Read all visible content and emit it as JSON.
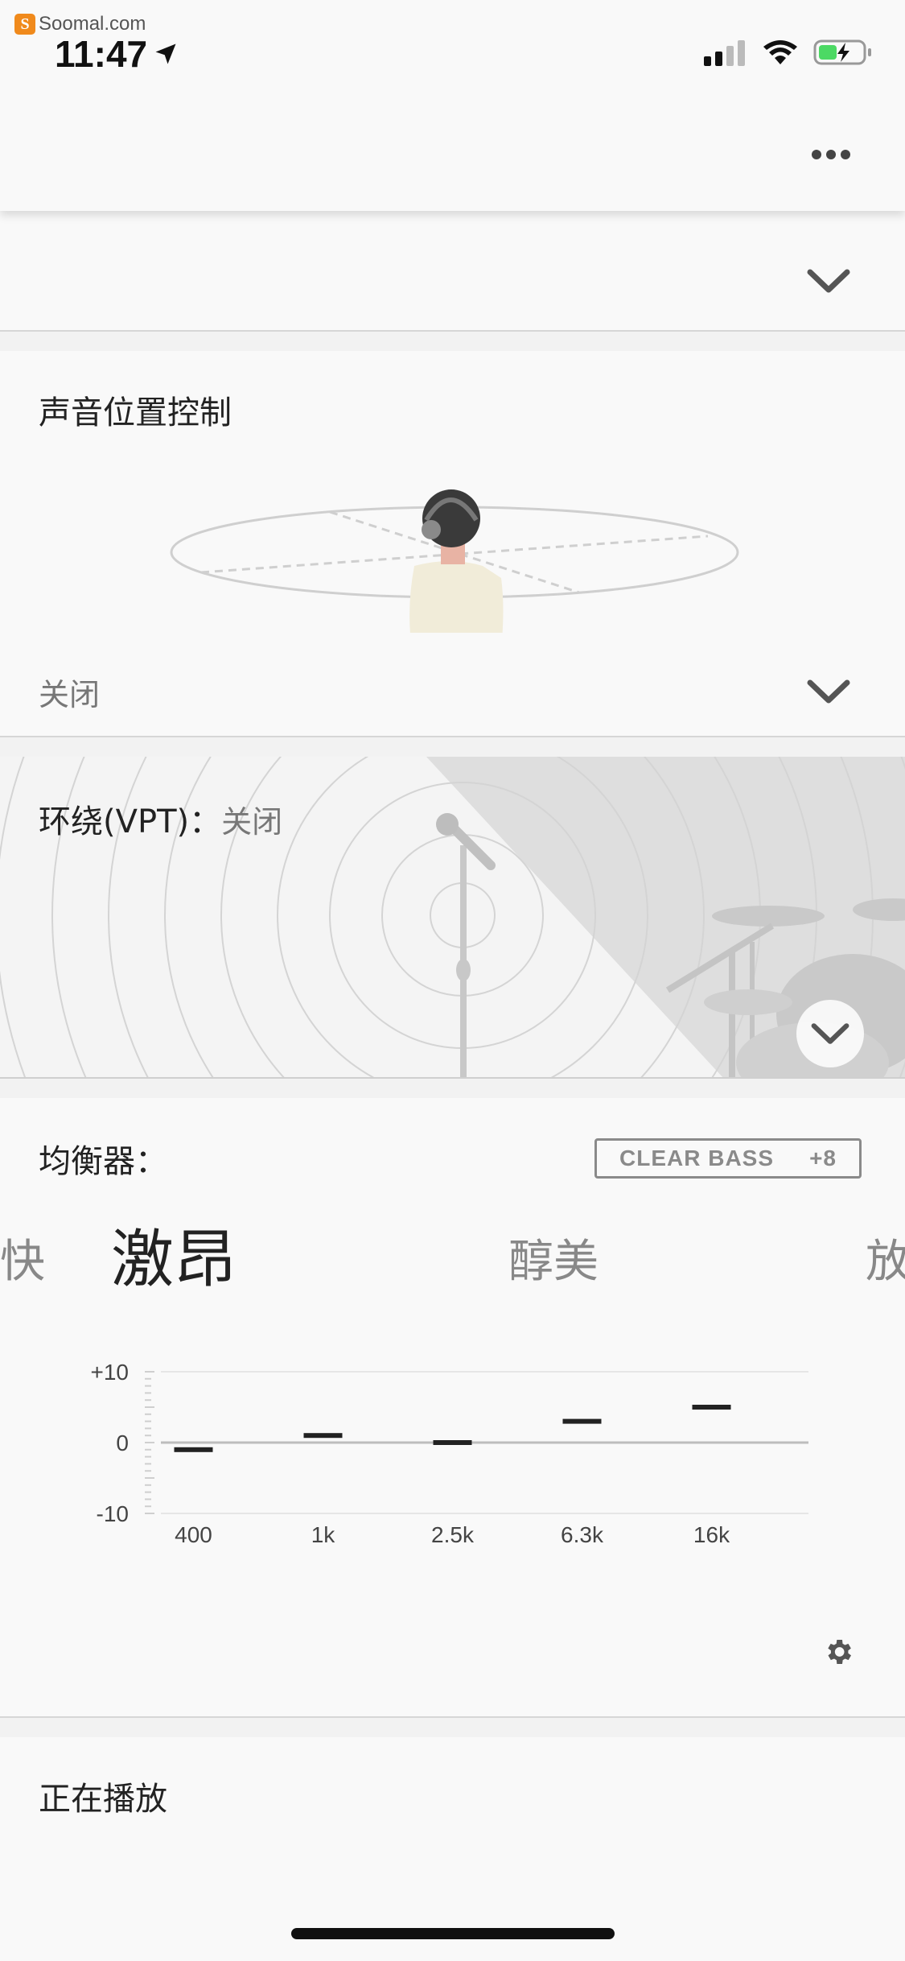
{
  "status_bar": {
    "watermark_letter": "S",
    "watermark": "Soomal.com",
    "time": "11:47"
  },
  "header": {
    "more_label": "more"
  },
  "sound_position": {
    "title": "声音位置控制",
    "value": "关闭"
  },
  "vpt": {
    "label": "环绕(VPT)：",
    "value": "关闭"
  },
  "equalizer": {
    "title": "均衡器：",
    "clear_bass_label": "CLEAR BASS",
    "clear_bass_value": "+8",
    "presets": [
      "快",
      "激昂",
      "醇美",
      "放"
    ],
    "active_preset_index": 1,
    "y_ticks": [
      "+10",
      "0",
      "-10"
    ],
    "bands": [
      "400",
      "1k",
      "2.5k",
      "6.3k",
      "16k"
    ]
  },
  "chart_data": {
    "type": "bar",
    "categories": [
      "400",
      "1k",
      "2.5k",
      "6.3k",
      "16k"
    ],
    "values": [
      -1,
      1,
      0,
      3,
      5
    ],
    "ylim": [
      -10,
      10
    ],
    "y_ticks": [
      "+10",
      "0",
      "-10"
    ],
    "grid": true
  },
  "now_playing": {
    "title": "正在播放"
  },
  "colors": {
    "background": "#f9f9f9",
    "text": "#222222",
    "muted": "#777777",
    "watermark_orange": "#f08a1c"
  },
  "icons": {
    "location": "location-arrow-icon",
    "signal": "cellular-signal-icon",
    "wifi": "wifi-icon",
    "battery": "battery-charging-icon",
    "more": "more-dots-icon",
    "chevron": "chevron-down-icon",
    "settings": "gear-icon"
  }
}
